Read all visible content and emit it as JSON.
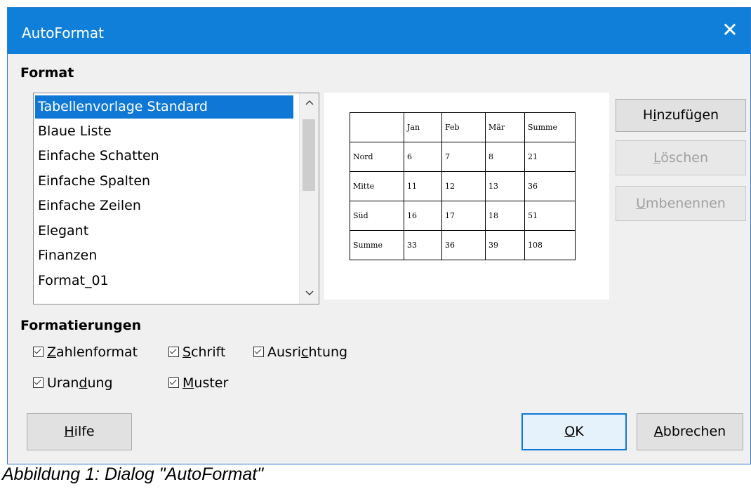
{
  "window": {
    "title": "AutoFormat",
    "close_glyph": "✕"
  },
  "format_section": {
    "label": "Format"
  },
  "format_list": {
    "items": [
      "Tabellenvorlage Standard",
      "Blaue Liste",
      "Einfache Schatten",
      "Einfache Spalten",
      "Einfache Zeilen",
      "Elegant",
      "Finanzen",
      "Format_01"
    ],
    "selected": "Tabellenvorlage Standard"
  },
  "preview": {
    "header": [
      "",
      "Jan",
      "Feb",
      "Mär",
      "Summe"
    ],
    "rows": [
      [
        "Nord",
        "6",
        "7",
        "8",
        "21"
      ],
      [
        "Mitte",
        "11",
        "12",
        "13",
        "36"
      ],
      [
        "Süd",
        "16",
        "17",
        "18",
        "51"
      ],
      [
        "Summe",
        "33",
        "36",
        "39",
        "108"
      ]
    ]
  },
  "buttons": {
    "add": {
      "before": "H",
      "mnemonic": "i",
      "after": "nzufügen"
    },
    "delete": {
      "before": "",
      "mnemonic": "L",
      "after": "öschen"
    },
    "rename": {
      "before": "",
      "mnemonic": "U",
      "after": "mbenennen"
    },
    "help": {
      "before": "",
      "mnemonic": "H",
      "after": "ilfe"
    },
    "ok": {
      "before": "",
      "mnemonic": "O",
      "after": "K"
    },
    "cancel": {
      "before": "",
      "mnemonic": "A",
      "after": "bbrechen"
    }
  },
  "formatting_section": {
    "label": "Formatierungen"
  },
  "checkboxes": {
    "number_format": {
      "before": "",
      "mnemonic": "Z",
      "after": "ahlenformat",
      "checked": true
    },
    "font": {
      "before": "",
      "mnemonic": "S",
      "after": "chrift",
      "checked": true
    },
    "alignment": {
      "before": "Ausri",
      "mnemonic": "c",
      "after": "htung",
      "checked": true
    },
    "border": {
      "before": "Uran",
      "mnemonic": "d",
      "after": "ung",
      "checked": true
    },
    "pattern": {
      "before": "",
      "mnemonic": "M",
      "after": "uster",
      "checked": true
    }
  },
  "caption": "Abbildung 1: Dialog \"AutoFormat\""
}
